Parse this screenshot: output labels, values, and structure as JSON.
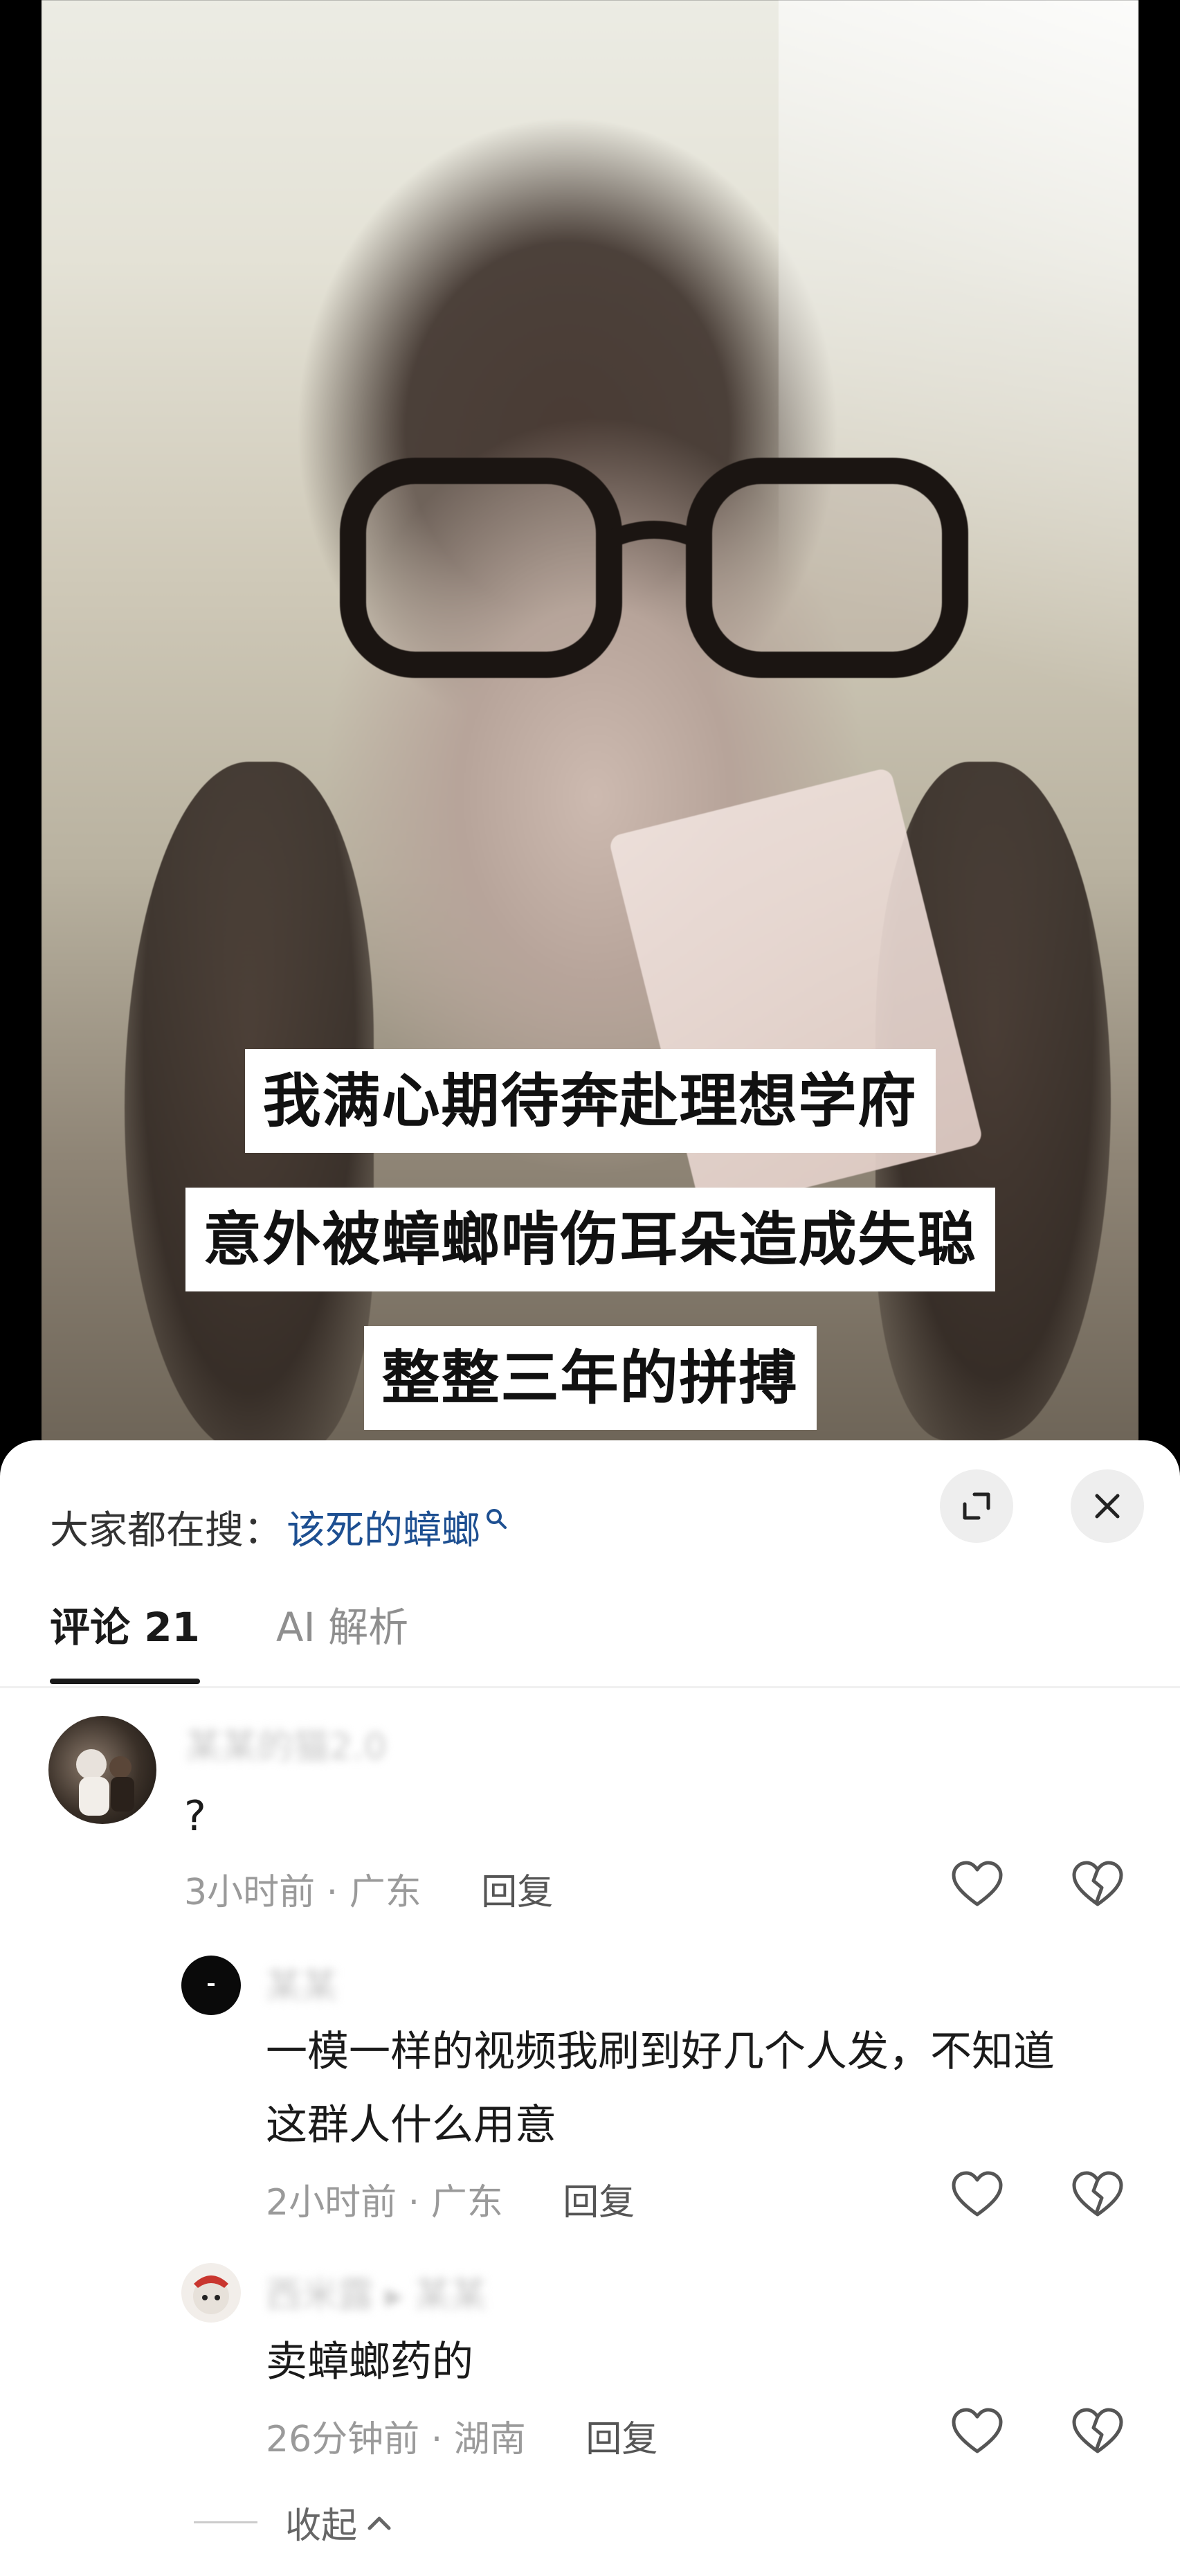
{
  "video": {
    "subtitles": [
      "我满心期待奔赴理想学府",
      "意外被蟑螂啃伤耳朵造成失聪",
      "整整三年的拼搏"
    ]
  },
  "sheet": {
    "search_prefix": "大家都在搜：",
    "search_term": "该死的蟑螂",
    "tabs": [
      {
        "label": "评论 21",
        "active": true
      },
      {
        "label": "AI 解析",
        "active": false
      }
    ]
  },
  "comments": [
    {
      "username": "某某的猫2.0",
      "text": "?",
      "time": "3小时前",
      "location": "广东",
      "reply_label": "回复"
    },
    {
      "username": "某某",
      "text_line1": "一模一样的视频我刷到好几个人发，不知道",
      "text_line2": "这群人什么用意",
      "time": "2小时前",
      "location": "广东",
      "reply_label": "回复"
    },
    {
      "username": "西米露 ▸ 某某",
      "text": "卖蟑螂药的",
      "time": "26分钟前",
      "location": "湖南",
      "reply_label": "回复"
    }
  ],
  "collapse_label": "收起",
  "colors": {
    "search_term": "#1d4f91",
    "text_primary": "#1a1a1a",
    "text_secondary": "#9a9a9a"
  }
}
